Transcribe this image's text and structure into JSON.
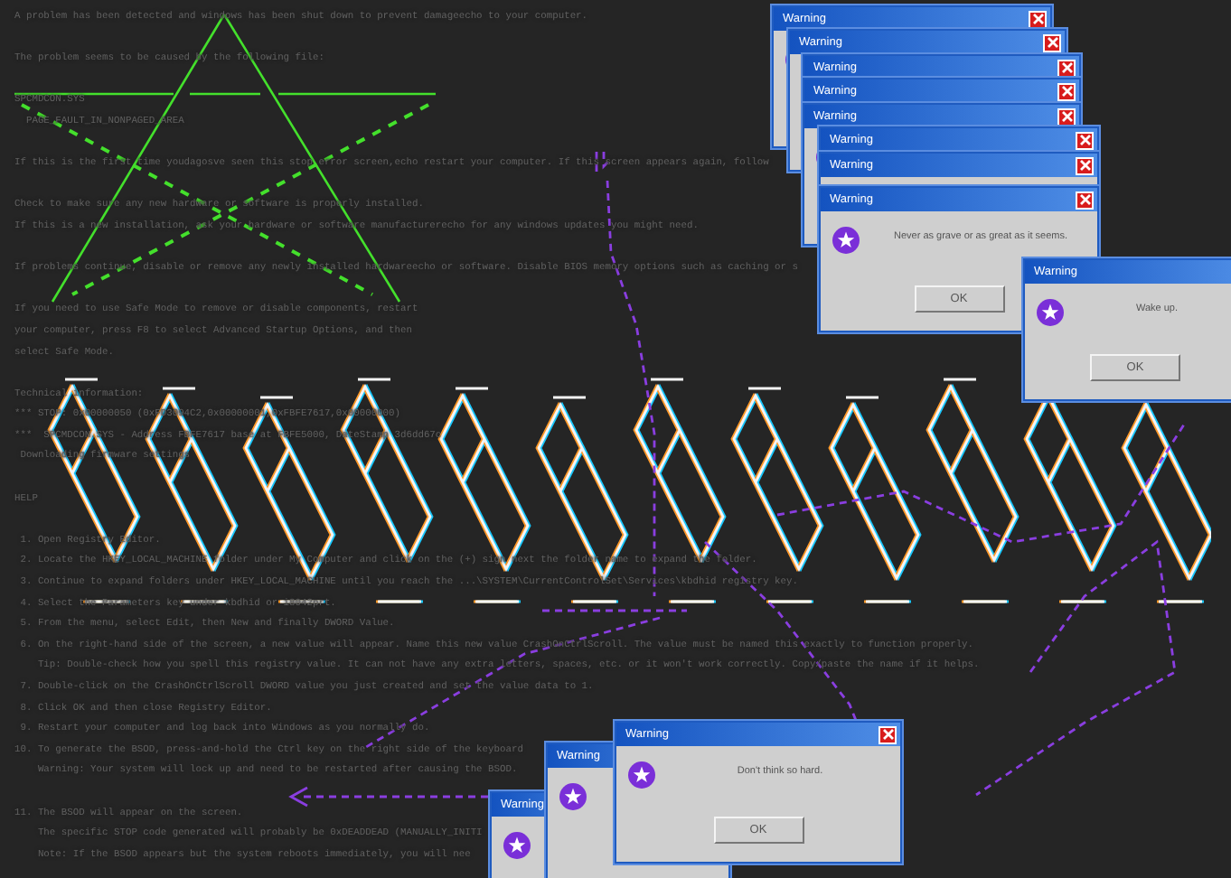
{
  "console": {
    "paragraphs": [
      [
        "A problem has been detected and windows has been shut down to prevent damageecho to your computer."
      ],
      [
        "The problem seems to be caused by the following file:"
      ],
      [
        "SPCMDCON.SYS",
        "  PAGE_FAULT_IN_NONPAGED_AREA"
      ],
      [
        "If this is the first time youdagosve seen this stop error screen,echo restart your computer. If this screen appears again, follow"
      ],
      [
        "Check to make sure any new hardware or software is properly installed.",
        "If this is a new installation, ask your hardware or software manufacturerecho for any windows updates you might need."
      ],
      [
        "If problems continue, disable or remove any newly installed hardwareecho or software. Disable BIOS memory options such as caching or s"
      ],
      [
        "If you need to use Safe Mode to remove or disable components, restart",
        "your computer, press F8 to select Advanced Startup Options, and then",
        "select Safe Mode."
      ],
      [
        "Technical information:",
        "*** STOP: 0x00000050 (0xFD3094C2,0x00000001,0xFBFE7617,0x00000000)",
        "***  SPCMDCON.SYS - Address FBFE7617 base at FBFE5000, DateStamp 3d6dd67c",
        " Downloading firmware settings"
      ],
      [
        "HELP"
      ],
      [
        " 1. Open Registry Editor.",
        " 2. Locate the HKEY_LOCAL_MACHINE folder under My Computer and click on the (+) sign next the folder name to expand the folder.",
        " 3. Continue to expand folders under HKEY_LOCAL_MACHINE until you reach the ...\\SYSTEM\\CurrentControlSet\\Services\\kbdhid registry key.",
        " 4. Select the Parameters key under kbdhid or i8042prt.",
        " 5. From the menu, select Edit, then New and finally DWORD Value.",
        " 6. On the right-hand side of the screen, a new value will appear. Name this new value CrashOnCtrlScroll. The value must be named this exactly to function properly.",
        "    Tip: Double-check how you spell this registry value. It can not have any extra letters, spaces, etc. or it won't work correctly. Copy/paste the name if it helps.",
        " 7. Double-click on the CrashOnCtrlScroll DWORD value you just created and set the value data to 1.",
        " 8. Click OK and then close Registry Editor.",
        " 9. Restart your computer and log back into Windows as you normally do.",
        "10. To generate the BSOD, press-and-hold the Ctrl key on the right side of the keyboard",
        "    Warning: Your system will lock up and need to be restarted after causing the BSOD."
      ],
      [
        "11. The BSOD will appear on the screen.",
        "    The specific STOP code generated will probably be 0xDEADDEAD (MANUALLY_INITI",
        "    Note: If the BSOD appears but the system reboots immediately, you will nee"
      ]
    ]
  },
  "dialogs": [
    {
      "title": "Warning",
      "has_close": true
    },
    {
      "title": "Warning",
      "has_close": true
    },
    {
      "title": "Warning",
      "has_close": true
    },
    {
      "title": "Warning",
      "has_close": true
    },
    {
      "title": "Warning",
      "has_close": true
    },
    {
      "title": "Warning",
      "has_close": true
    },
    {
      "title": "Warning",
      "has_close": true
    },
    {
      "title": "Warning",
      "has_close": true,
      "message": "Never as grave or as great as it seems.",
      "button": "OK"
    },
    {
      "title": "Warning",
      "has_close": false,
      "message": "Wake up.",
      "button": "OK"
    },
    {
      "title": "Warning",
      "has_close": false
    },
    {
      "title": "Warning",
      "has_close": false
    },
    {
      "title": "Warning",
      "has_close": true,
      "message": "Don't think so hard.",
      "button": "OK"
    }
  ]
}
